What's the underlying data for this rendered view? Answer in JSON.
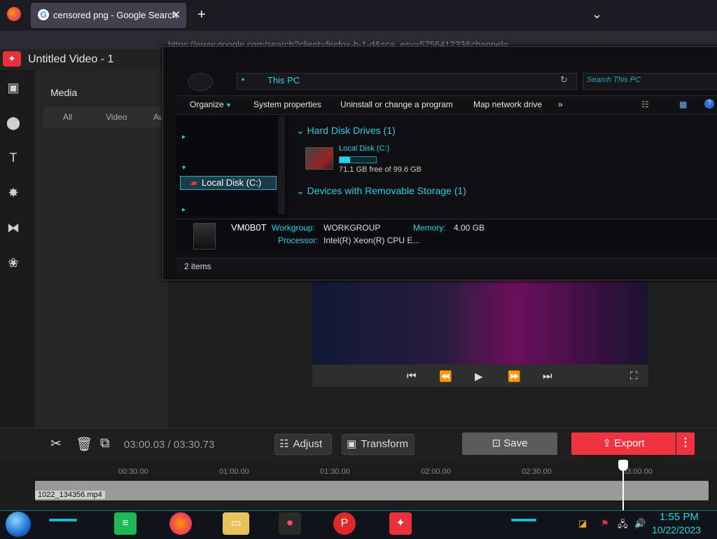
{
  "browser": {
    "tab_title": "censored png - Google Search",
    "tab_close": "✕",
    "new_tab": "+",
    "menu_chevron": "⌄",
    "url": "https://www.google.com/search?client=firefox-b-1-d&sca_esv=575641233&channel=..."
  },
  "editor": {
    "title": "Untitled Video - 1",
    "media": {
      "title": "Media",
      "tabs": [
        "All",
        "Video",
        "Au"
      ]
    },
    "toolbar": {
      "time_current": "03:00.03",
      "time_sep": " / ",
      "time_total": "03:30.73",
      "adjust_label": "Adjust",
      "transform_label": "Transform",
      "save_label": "Save",
      "export_label": "Export",
      "more_label": "⋮"
    },
    "timeline": {
      "ruler": [
        "00:30.00",
        "01:00.00",
        "01:30.00",
        "02:00.00",
        "02:30.00",
        "03:00.00"
      ],
      "clip_name": "1022_134356.mp4",
      "playhead_fraction": 0.855
    },
    "colors": {
      "accent": "#ef3340",
      "save": "#5b5b5b"
    }
  },
  "explorer": {
    "breadcrumb": "This PC",
    "search_placeholder": "Search This PC",
    "commands": [
      "Organize",
      "System properties",
      "Uninstall or change a program",
      "Map network drive",
      "»"
    ],
    "nav_selected": "Local Disk (C:)",
    "groups": {
      "hard_disk": "Hard Disk Drives (1)",
      "removable": "Devices with Removable Storage (1)"
    },
    "drive": {
      "name": "Local Disk (C:)",
      "free": "71.1 GB free of 99.6 GB",
      "used_fraction": 0.286
    },
    "details": {
      "computer_name": "VM0B0T",
      "workgroup_label": "Workgroup:",
      "workgroup_value": "WORKGROUP",
      "memory_label": "Memory:",
      "memory_value": "4.00 GB",
      "processor_label": "Processor:",
      "processor_value": "Intel(R) Xeon(R) CPU E..."
    },
    "status": "2 items",
    "colors": {
      "accent": "#22d4e8"
    }
  },
  "taskbar": {
    "time": "1:55 PM",
    "date": "10/22/2023",
    "apps": [
      "spotify-icon",
      "firefox-icon",
      "file-explorer-icon",
      "screen-recorder-icon",
      "picsart-icon",
      "video-editor-icon"
    ]
  }
}
